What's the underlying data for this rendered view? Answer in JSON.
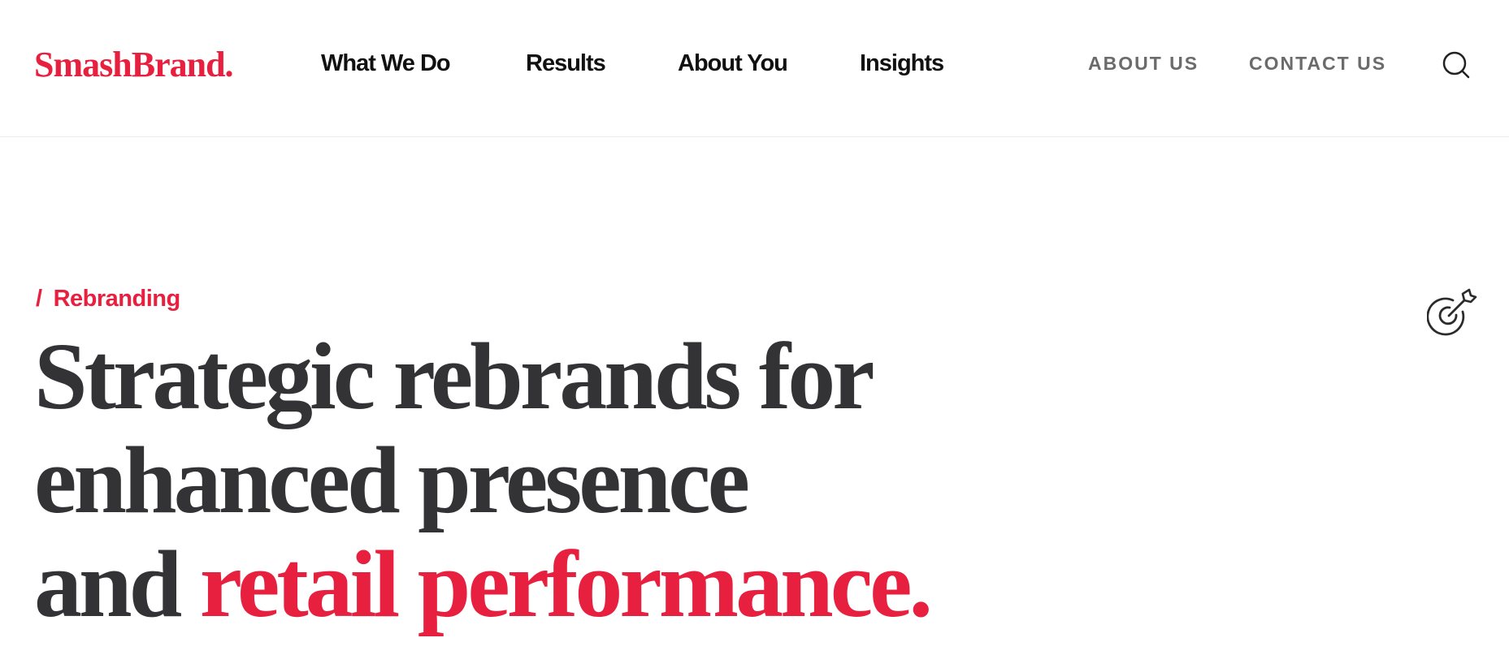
{
  "brand": {
    "name": "SmashBrand.",
    "accent_color": "#e8203f",
    "text_color": "#333235"
  },
  "nav": {
    "primary": [
      {
        "label": "What We Do"
      },
      {
        "label": "Results"
      },
      {
        "label": "About You"
      },
      {
        "label": "Insights"
      }
    ],
    "utility": [
      {
        "label": "ABOUT US"
      },
      {
        "label": "CONTACT US"
      }
    ],
    "search_icon": "search-icon"
  },
  "hero": {
    "eyebrow_slash": "/",
    "eyebrow": "Rebranding",
    "headline_line1": "Strategic rebrands for",
    "headline_line2": "enhanced presence",
    "headline_line3_prefix": "and",
    "headline_accent": "retail performance.",
    "icon": "target-arrow-icon"
  }
}
